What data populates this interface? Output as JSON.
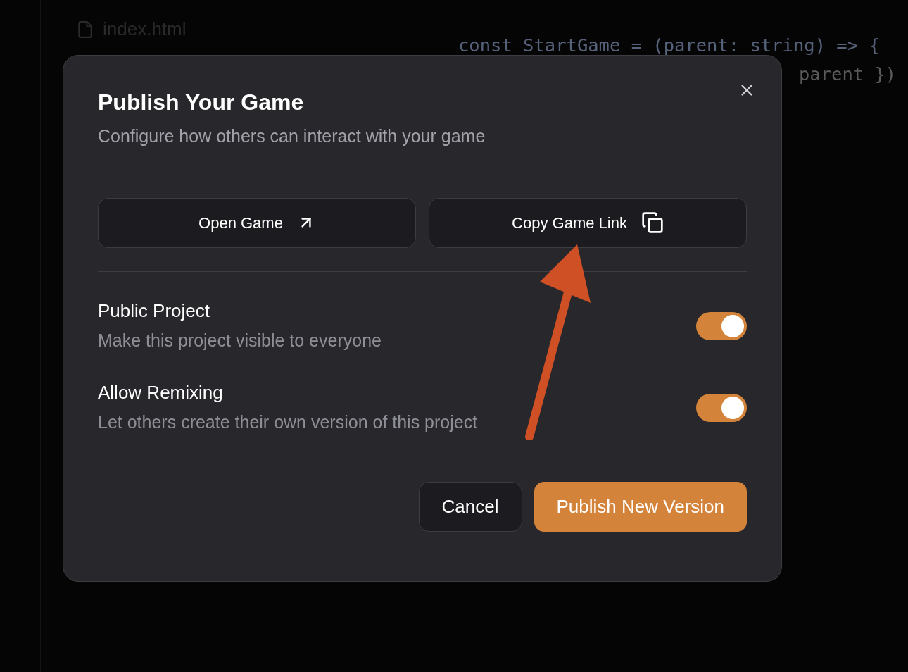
{
  "file_tree": {
    "items": [
      {
        "name": "index.html"
      }
    ]
  },
  "code_editor": {
    "lines": [
      "const StartGame = (parent: string) => {",
      "parent })"
    ]
  },
  "dialog": {
    "title": "Publish Your Game",
    "subtitle": "Configure how others can interact with your game",
    "actions": [
      {
        "label": "Open Game",
        "kind": "open"
      },
      {
        "label": "Copy Game Link",
        "kind": "copy"
      }
    ],
    "settings": [
      {
        "title": "Public Project",
        "description": "Make this project visible to everyone",
        "on": true
      },
      {
        "title": "Allow Remixing",
        "description": "Let others create their own version of this project",
        "on": true
      }
    ],
    "footer": {
      "cancel": "Cancel",
      "publish": "Publish New Version"
    }
  }
}
